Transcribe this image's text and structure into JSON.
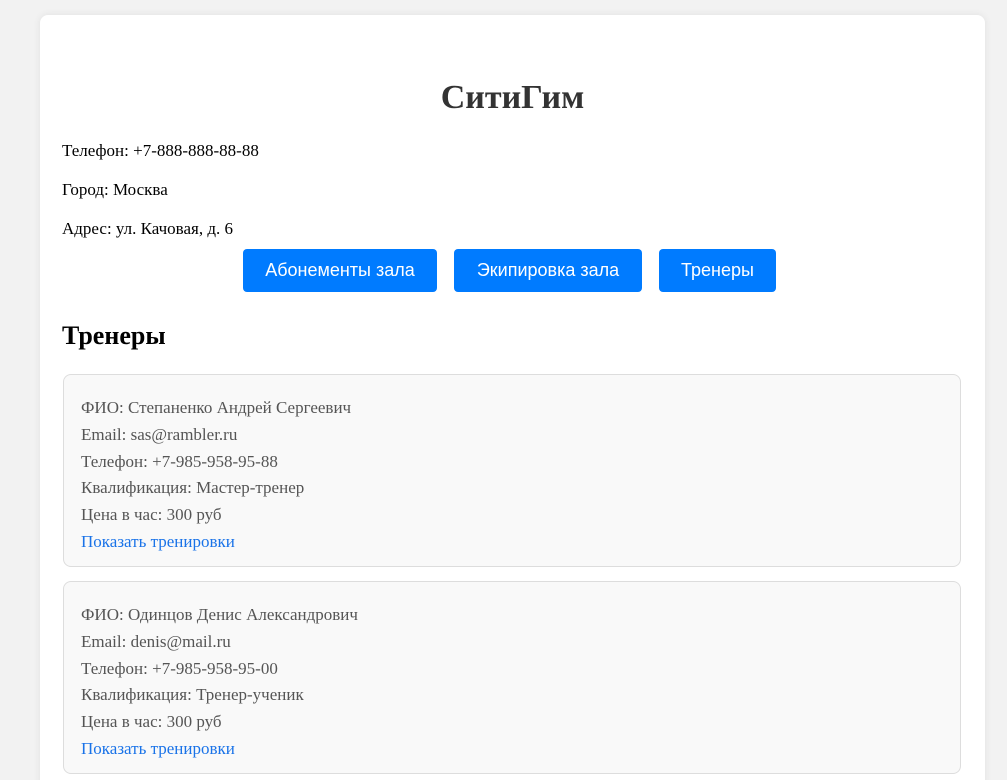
{
  "gym": {
    "name": "СитиГим",
    "phone": "Телефон: +7-888-888-88-88",
    "city": "Город: Москва",
    "address": "Адрес: ул. Качовая, д. 6"
  },
  "nav": {
    "memberships": "Абонементы зала",
    "equipment": "Экипировка зала",
    "trainers": "Тренеры"
  },
  "section": {
    "title": "Тренеры"
  },
  "trainers": [
    {
      "fio": "ФИО: Степаненко Андрей Сергеевич",
      "email": "Email: sas@rambler.ru",
      "phone": "Телефон: +7-985-958-95-88",
      "qualification": "Квалификация: Мастер-тренер",
      "price": "Цена в час: 300 руб",
      "link": "Показать тренировки"
    },
    {
      "fio": "ФИО: Одинцов Денис Александрович",
      "email": "Email: denis@mail.ru",
      "phone": "Телефон: +7-985-958-95-00",
      "qualification": "Квалификация: Тренер-ученик",
      "price": "Цена в час: 300 руб",
      "link": "Показать тренировки"
    }
  ],
  "colors": {
    "accent": "#007bff",
    "link": "#1a73e8",
    "card_bg": "#f9f9f9",
    "card_border": "#dddddd"
  }
}
